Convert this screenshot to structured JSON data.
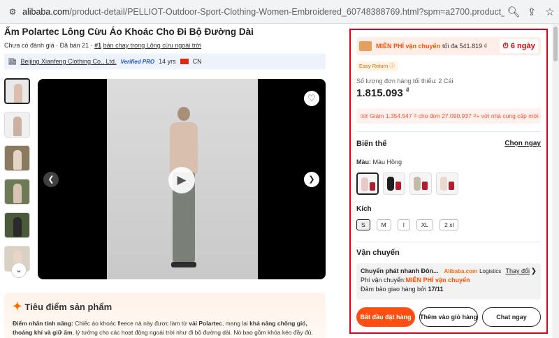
{
  "browser": {
    "url_host": "alibaba.com",
    "url_path": "/product-detail/PELLIOT-Outdoor-Sport-Clothing-Women-Embroidered_60748388769.html?spm=a2700.product_home_fy25.just_for_yo...",
    "icons": [
      "tune-icon",
      "search-icon",
      "share-icon",
      "star-icon"
    ]
  },
  "product": {
    "title": "Áo khoác lông cừu Polartec cho đi bộ đường dài",
    "title_display": "Ấm Polartec Lông Cừu Áo Khoác Cho Đi Bộ Đường Dài",
    "reviews": "Chưa có đánh giá · Đã bán 21 ·",
    "rank": "#1",
    "rank_text": "bán chạy trong Lông cừu ngoài trời",
    "supplier_name": "Beijing Xianfeng Clothing Co., Ltd.",
    "verified": "Verified PRO",
    "years": "14 yrs",
    "country": "CN"
  },
  "highlights": {
    "heading": "Tiêu điểm sản phẩm",
    "text_label": "Điểm nhấn tính năng:",
    "text_1": " Chiếc áo khoác fleece nà này được làm từ ",
    "text_bold_1": "vải Polartec",
    "text_2": ", mang lại ",
    "text_bold_2": "khả năng chống gió, thoáng khí và giữ ấm",
    "text_3": ", lý tưởng cho các hoạt động ngoài trời như đi bộ đường dài. Nó bao gồm khóa kéo đầy đủ, túi đựng và"
  },
  "purchase": {
    "ship_free": "MIỄN PHÍ vận chuyển",
    "ship_limit": "tối đa 541.819 ₫",
    "ship_days": "⏱ 6 ngày",
    "easy_return": "Easy Return ⓘ",
    "min_order": "Số lượng đơn hàng tối thiểu: 2 Cái",
    "price": "1.815.093",
    "currency": "₫",
    "coupon": "Giảm 1.354.547 ₫ cho đơn 27.090.937 ₫+ với nhà cung cấp mới",
    "variants_title": "Biến thể",
    "choose_now": "Chọn ngay",
    "color_label": "Màu:",
    "color_value": "Màu Hồng",
    "size_label": "Kích",
    "sizes": [
      "S",
      "M",
      "l",
      "XL",
      "2 xl"
    ],
    "selected_size": "S",
    "shipping_title": "Vận chuyển",
    "shipping_method": "Chuyển phát nhanh Đôn...",
    "shipping_brand": "Alibaba.com",
    "shipping_logistics": "Logistics",
    "shipping_change": "Thay đổi",
    "shipping_fee_label": "Phí vận chuyển:",
    "shipping_fee_value": "MIỄN PHÍ vận chuyển",
    "delivery_label": "Đảm bảo giao hàng bởi",
    "delivery_date": "17/11",
    "btn_order": "Bắt đầu đặt hàng",
    "btn_cart": "Thêm vào giỏ hàng",
    "btn_chat": "Chat ngay"
  },
  "colors": {
    "accent": "#ff4e11",
    "highlight_border": "#e0001b",
    "swatches": [
      "#e8c9c5",
      "#1e1e1e",
      "#c7b9a5",
      "#e9d9cf"
    ]
  }
}
